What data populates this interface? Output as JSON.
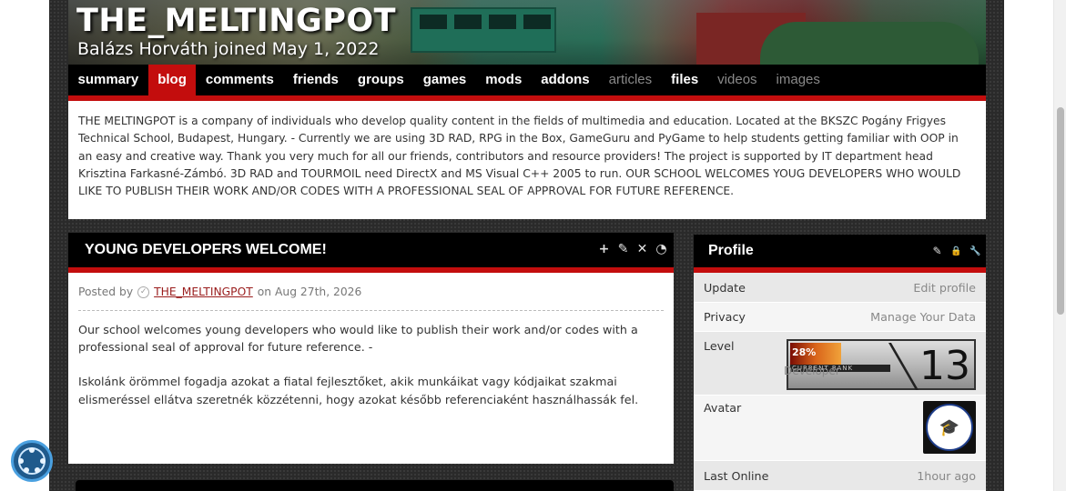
{
  "header": {
    "title": "THE_MELTINGPOT",
    "subtitle": "Balázs Horváth joined May 1, 2022"
  },
  "nav": {
    "tabs": [
      {
        "label": "summary",
        "state": "normal"
      },
      {
        "label": "blog",
        "state": "active"
      },
      {
        "label": "comments",
        "state": "normal"
      },
      {
        "label": "friends",
        "state": "normal"
      },
      {
        "label": "groups",
        "state": "normal"
      },
      {
        "label": "games",
        "state": "normal"
      },
      {
        "label": "mods",
        "state": "normal"
      },
      {
        "label": "addons",
        "state": "normal"
      },
      {
        "label": "articles",
        "state": "disabled"
      },
      {
        "label": "files",
        "state": "normal"
      },
      {
        "label": "videos",
        "state": "disabled"
      },
      {
        "label": "images",
        "state": "disabled"
      }
    ]
  },
  "intro": {
    "text": "THE MELTINGPOT is a company of individuals who develop quality content in the fields of multimedia and education. Located at the BKSZC Pogány Frigyes Technical School, Budapest, Hungary. - Currently we are using 3D RAD, RPG in the Box, GameGuru and PyGame to help students getting familiar with OOP in an easy and creative way. Thank you very much for all our friends, contributors and resource providers! The project is supported by IT department head Krisztina Farkasné-Zámbó. 3D RAD and TOURMOIL need DirectX and MS Visual C++ 2005 to run. OUR SCHOOL WELCOMES YOUG DEVELOPERS WHO WOULD LIKE TO PUBLISH THEIR WORK AND/OR CODES WITH A PROFESSIONAL SEAL OF APPROVAL FOR FUTURE REFERENCE."
  },
  "blog": {
    "title": "YOUNG DEVELOPERS WELCOME!",
    "posted_by": "Posted by",
    "author": "THE_MELTINGPOT",
    "date": "on Aug 27th, 2026",
    "para1": "Our school welcomes young developers who would like to publish their work and/or codes with a professional seal of approval for future reference. -",
    "para2": "Iskolánk örömmel fogadja azokat a fiatal fejlesztőket, akik munkáikat vagy kódjaikat szakmai elismeréssel ellátva szeretnék közzétenni, hogy azokat később referenciaként használhassák fel.",
    "tools": {
      "add": "+",
      "edit": "✎",
      "delete": "✕",
      "rss": "◔"
    }
  },
  "profile": {
    "title": "Profile",
    "tools": {
      "edit": "✎",
      "lock": "🔒",
      "wrench": "🔧"
    },
    "rows": {
      "update_label": "Update",
      "update_value": "Edit profile",
      "privacy_label": "Privacy",
      "privacy_value": "Manage Your Data",
      "level_label": "Level",
      "avatar_label": "Avatar",
      "last_online_label": "Last Online",
      "last_online_value": "1hour ago"
    },
    "level": {
      "percent": "28%",
      "progress": 0.28,
      "rank_text": "CURRENT RANK",
      "number": "13",
      "title": "Developer"
    }
  },
  "colors": {
    "accent_red": "#c30d0d",
    "link_red": "#9a1d1d",
    "chat_blue": "#1f5a8c"
  }
}
